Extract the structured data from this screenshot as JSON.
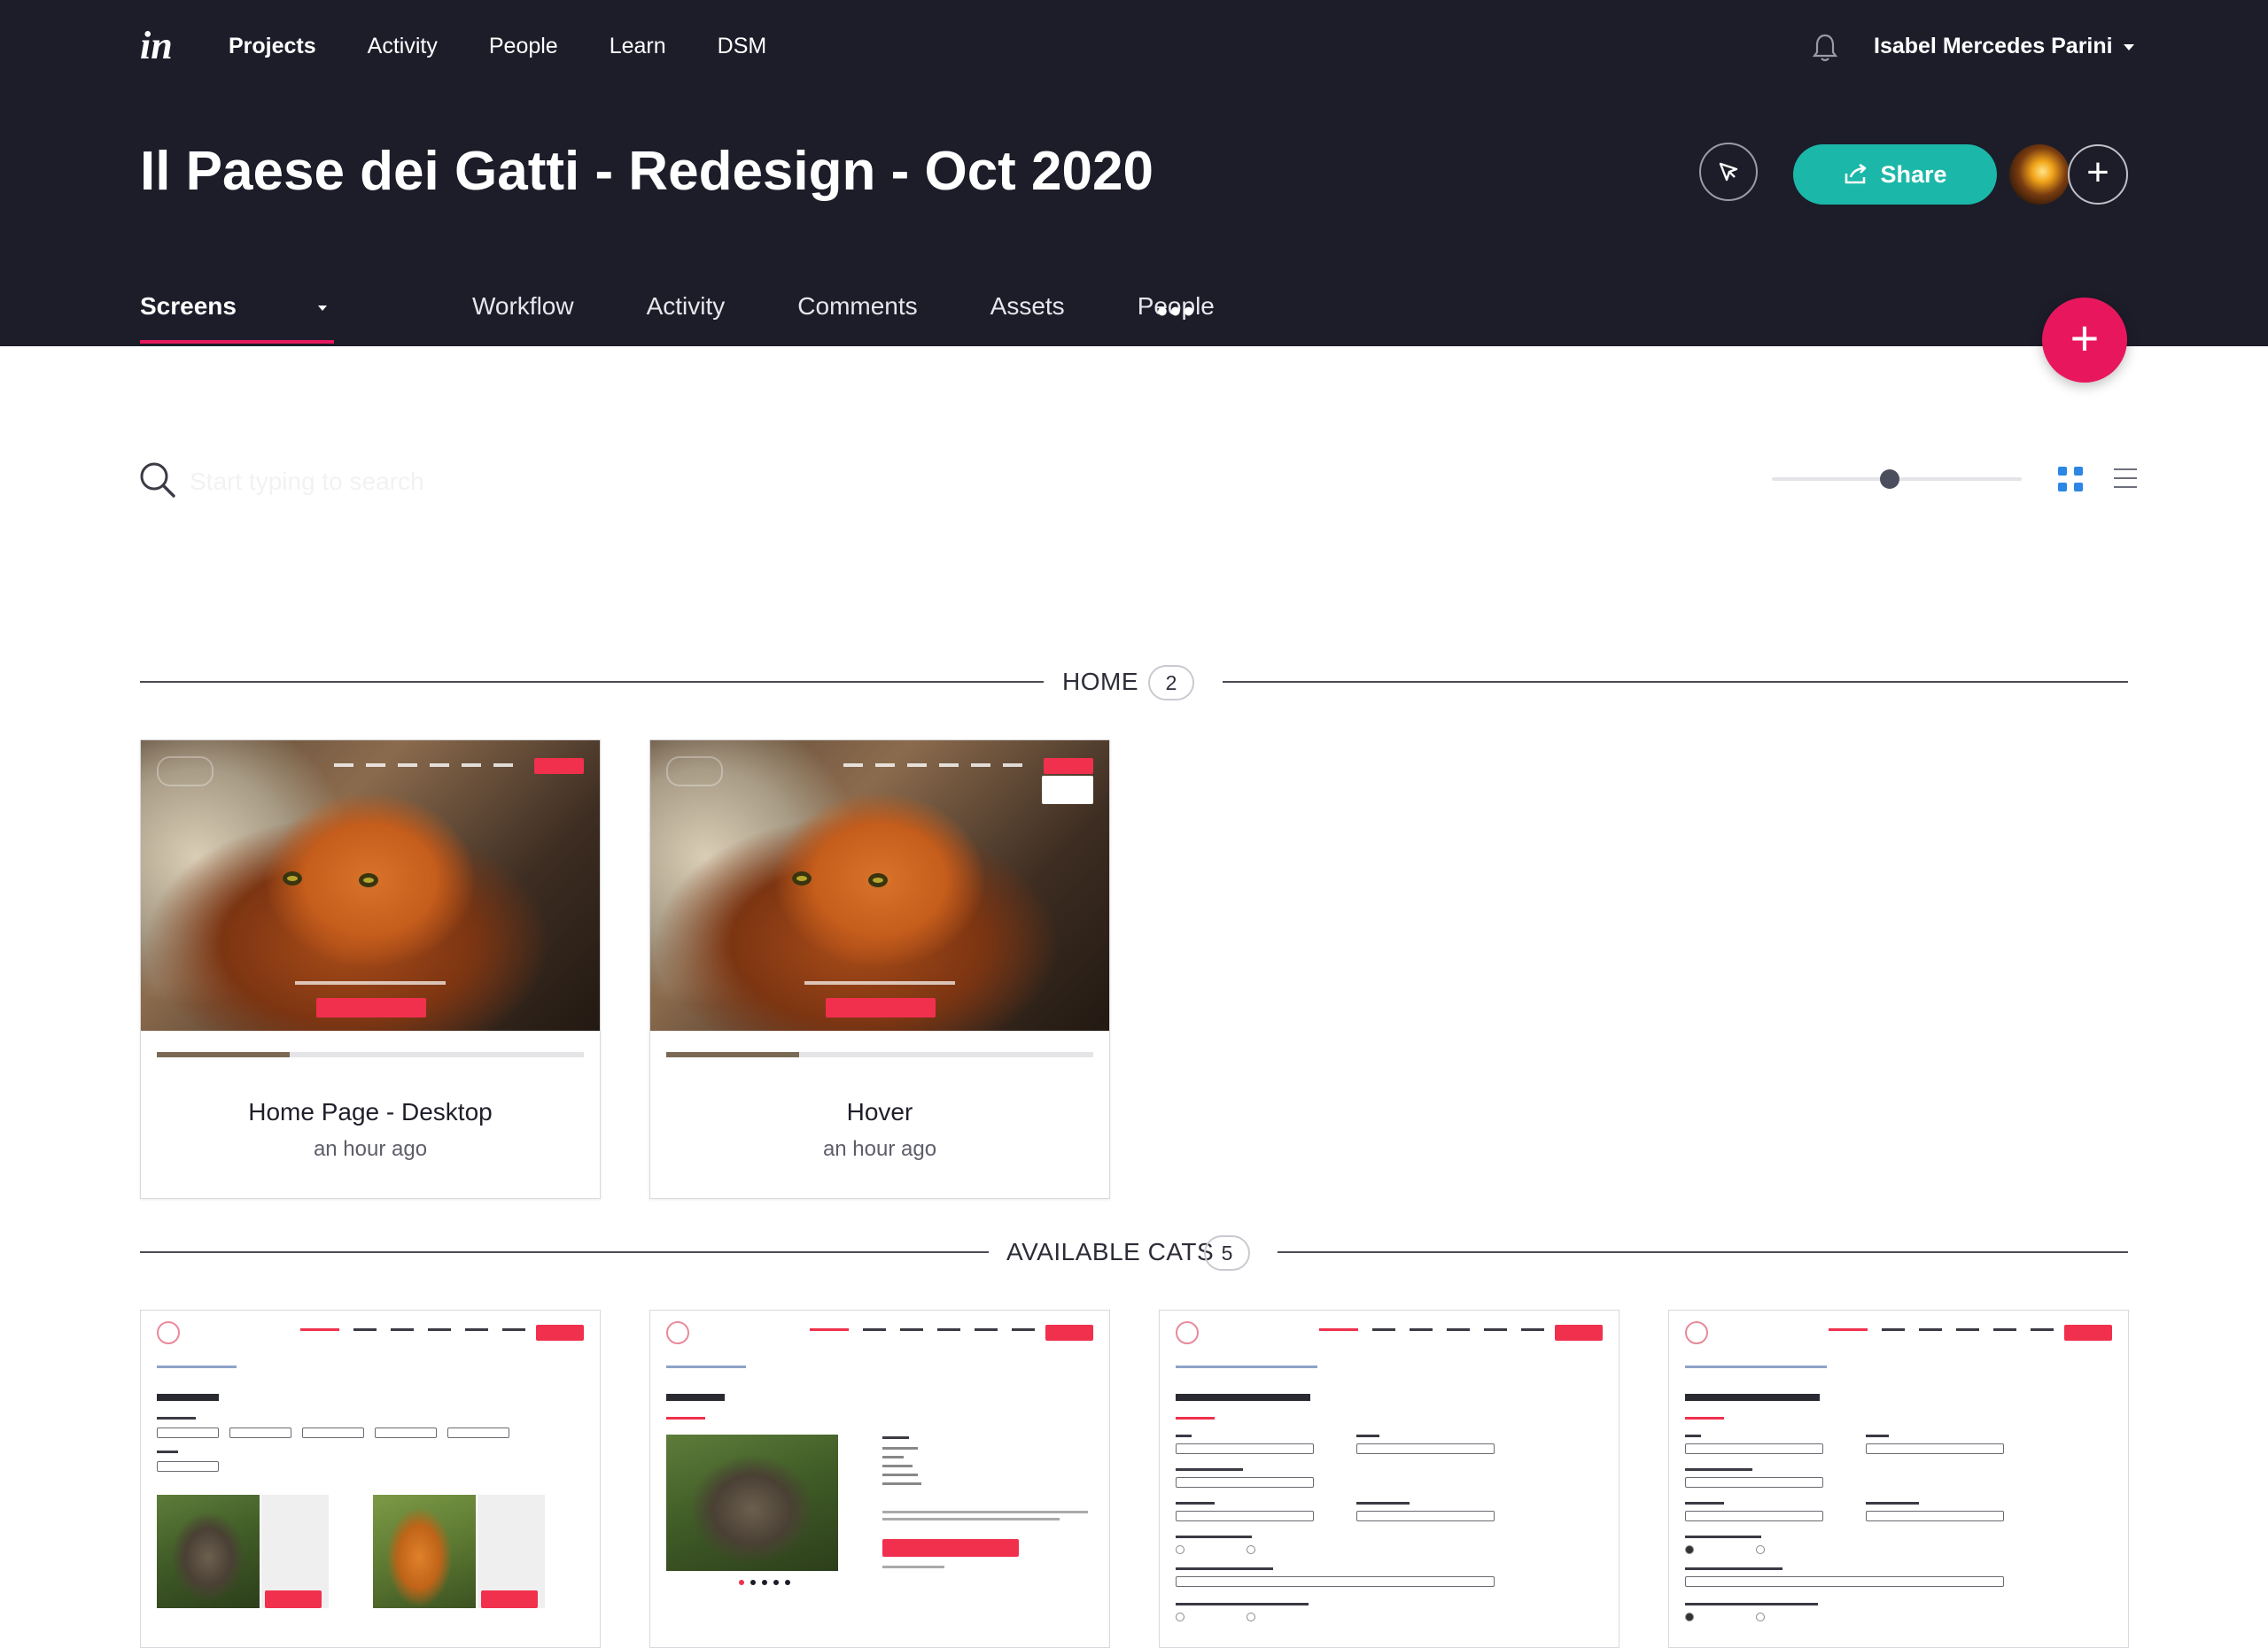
{
  "topnav": {
    "logo": "in",
    "items": [
      "Projects",
      "Activity",
      "People",
      "Learn",
      "DSM"
    ],
    "active": "Projects",
    "user_name": "Isabel Mercedes Parini"
  },
  "project": {
    "title": "Il Paese dei Gatti - Redesign - Oct 2020",
    "share_label": "Share"
  },
  "subnav": {
    "tabs": [
      "Screens",
      "Workflow",
      "Activity",
      "Comments",
      "Assets",
      "People"
    ],
    "active": "Screens",
    "more": "•••"
  },
  "toolbar": {
    "search_placeholder": "Start typing to search"
  },
  "sections": [
    {
      "name": "HOME",
      "count": "2",
      "screens": [
        {
          "name": "Home Page - Desktop",
          "time": "an hour ago"
        },
        {
          "name": "Hover",
          "time": "an hour ago"
        }
      ]
    },
    {
      "name": "AVAILABLE CATS",
      "count": "5"
    }
  ],
  "colors": {
    "header_bg": "#1c1d29",
    "accent_pink": "#e8175d",
    "share_teal": "#1bb7a8",
    "view_toggle_blue": "#2b86e5"
  }
}
